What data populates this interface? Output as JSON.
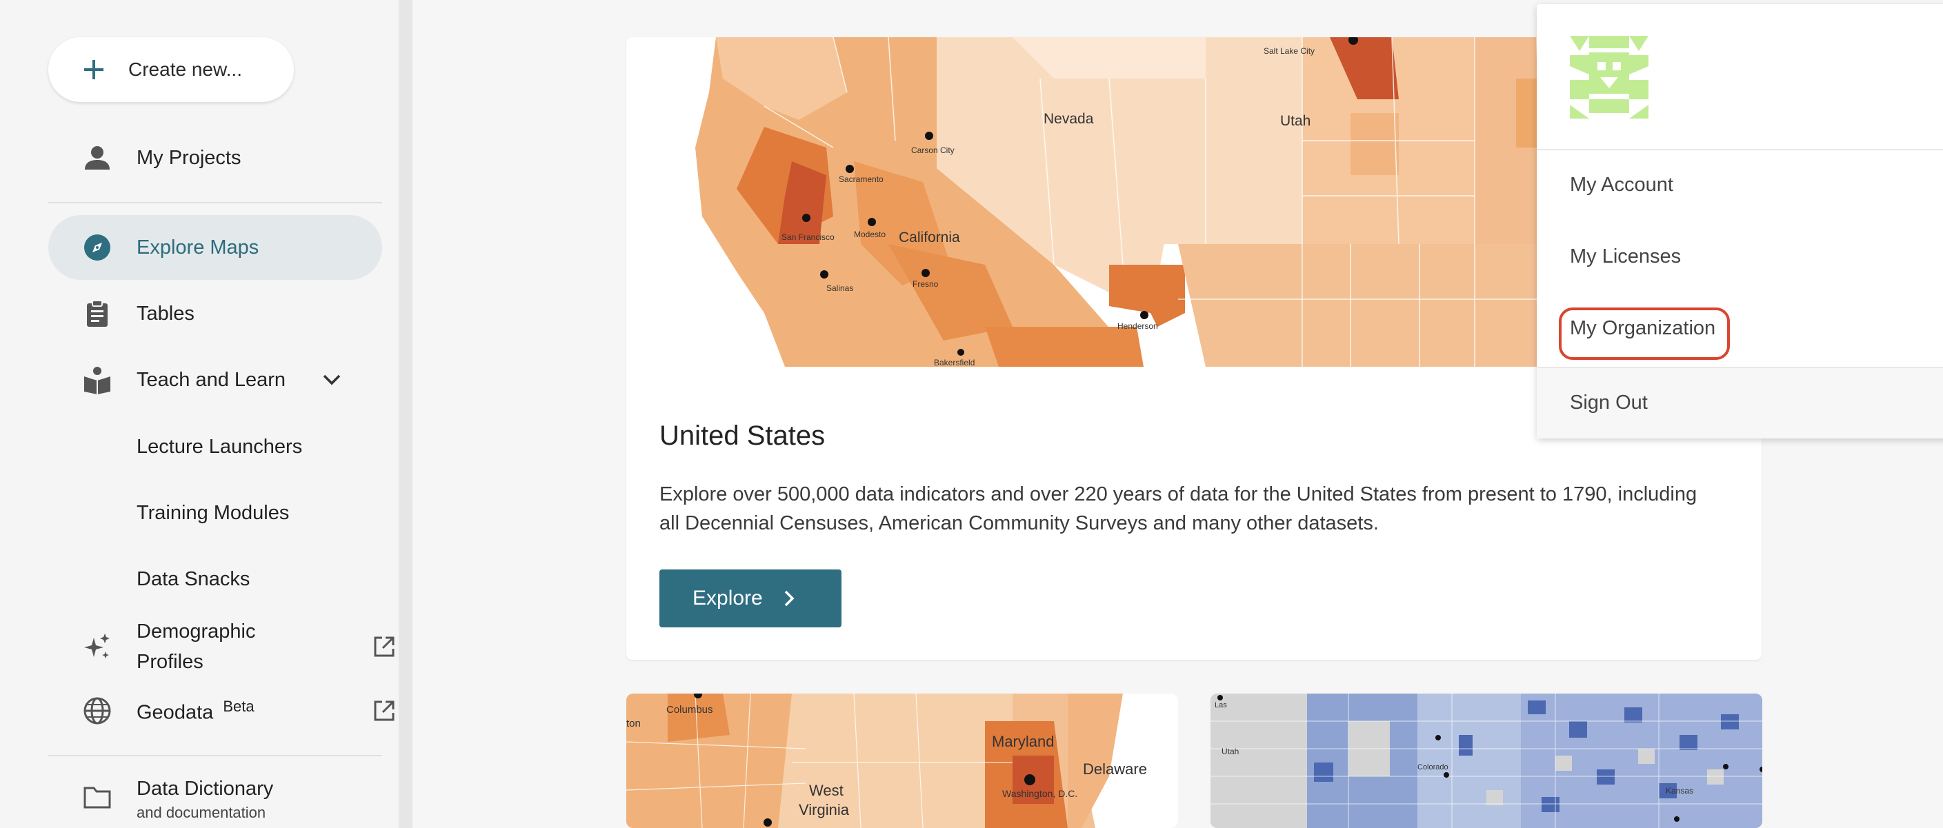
{
  "sidebar": {
    "create_label": "Create new...",
    "items": [
      {
        "label": "My Projects",
        "icon": "person-icon"
      },
      {
        "label": "Explore Maps",
        "icon": "compass-icon",
        "active": true
      },
      {
        "label": "Tables",
        "icon": "clipboard-icon"
      },
      {
        "label": "Teach and Learn",
        "icon": "book-reader-icon"
      },
      {
        "label": "Demographic Profiles",
        "icon": "sparkle-icon"
      },
      {
        "label": "Geodata",
        "icon": "globe-icon",
        "badge": "Beta"
      },
      {
        "label": "Data Dictionary",
        "sublabel": "and documentation",
        "icon": "folder-icon"
      }
    ],
    "teach_sub": [
      "Lecture Launchers",
      "Training Modules",
      "Data Snacks"
    ],
    "demographic_line1": "Demographic",
    "demographic_line2": "Profiles"
  },
  "main": {
    "card": {
      "title": "United States",
      "description": "Explore over 500,000 data indicators and over 220 years of data for the United States from present to 1790, including all Decennial Censuses, American Community Surveys and many other datasets.",
      "explore_label": "Explore",
      "map_labels": {
        "nevada": "Nevada",
        "utah": "Utah",
        "california": "California",
        "carson": "Carson City",
        "sacramento": "Sacramento",
        "modesto": "Modesto",
        "fresno": "Fresno",
        "salinas": "Salinas",
        "sf": "San Francisco",
        "henderson": "Henderson",
        "bakersfield": "Bakersfield",
        "slc": "Salt Lake City"
      }
    },
    "thumb_left_labels": {
      "columbus": "Columbus",
      "maryland": "Maryland",
      "delaware": "Delaware",
      "west": "West",
      "virginia": "Virginia",
      "washington": "Washington, D.C.",
      "ton": "ton"
    },
    "thumb_right_labels": {
      "las": "Las",
      "utah": "Utah",
      "colorado": "Colorado",
      "kansas": "Kansas"
    }
  },
  "dropdown": {
    "items": [
      "My Account",
      "My Licenses",
      "My Organization",
      "Sign Out"
    ]
  },
  "colors": {
    "accent": "#2e6e80",
    "highlight": "#d9452f",
    "active_bg": "#e3e9ea",
    "avatar": "#c2ec94"
  }
}
